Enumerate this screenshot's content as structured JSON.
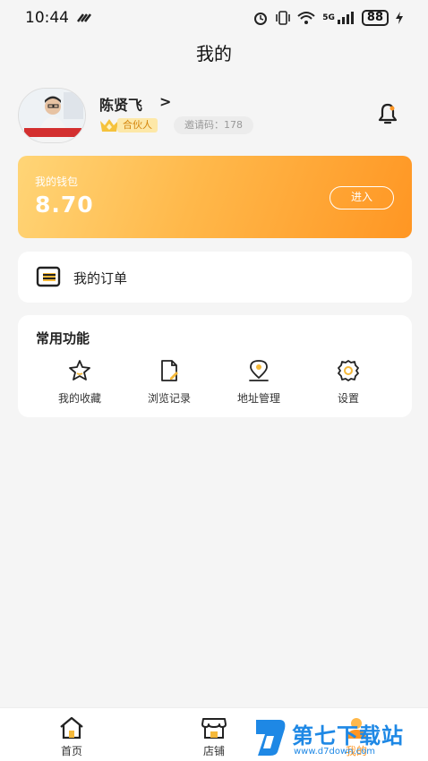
{
  "status_bar": {
    "time": "10:44",
    "network": "5G",
    "battery": "88"
  },
  "nav": {
    "title": "我的"
  },
  "profile": {
    "name": "陈贤飞",
    "chevron": ">",
    "badge": "合伙人",
    "invite_code": "邀请码：178"
  },
  "wallet": {
    "label": "我的钱包",
    "amount": "8.70",
    "enter_label": "进入"
  },
  "orders": {
    "label": "我的订单"
  },
  "functions": {
    "title": "常用功能",
    "items": [
      {
        "label": "我的收藏",
        "icon": "star-icon"
      },
      {
        "label": "浏览记录",
        "icon": "history-icon"
      },
      {
        "label": "地址管理",
        "icon": "location-icon"
      },
      {
        "label": "设置",
        "icon": "gear-icon"
      }
    ]
  },
  "tabbar": {
    "items": [
      {
        "label": "首页",
        "icon": "home-icon"
      },
      {
        "label": "店铺",
        "icon": "store-icon"
      },
      {
        "label": "我的",
        "icon": "user-icon",
        "active": true
      }
    ]
  },
  "watermark": {
    "brand": "第七下载站",
    "url": "www.d7down.com"
  },
  "colors": {
    "accent": "#ff9623",
    "gold": "#ffd577"
  }
}
